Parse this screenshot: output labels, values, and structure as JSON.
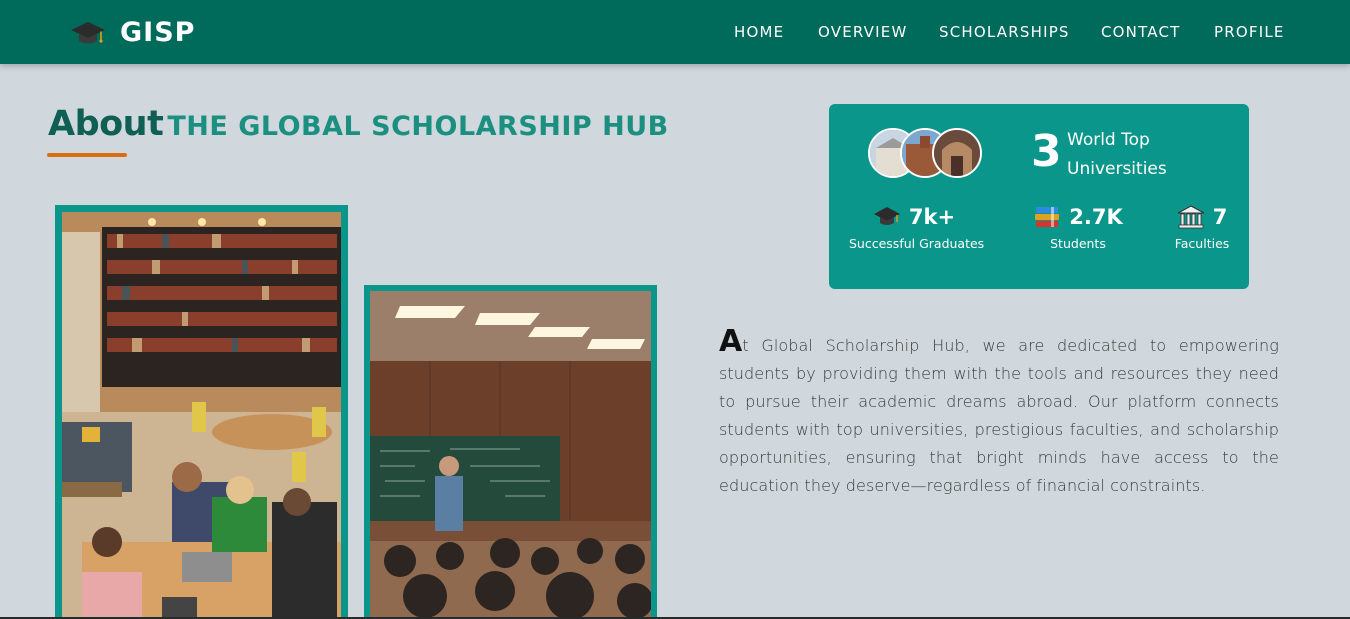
{
  "nav": {
    "brand": "GISP",
    "links": [
      "HOME",
      "OVERVIEW",
      "SCHOLARSHIPS",
      "CONTACT",
      "PROFILE"
    ]
  },
  "about": {
    "title": "About",
    "subtitle": "THE GLOBAL SCHOLARSHIP HUB"
  },
  "stats": {
    "universities_count": "3",
    "universities_label": "World Top Universities",
    "items": [
      {
        "value": "7k+",
        "label": "Successful Graduates",
        "icon": "graduation-cap-icon"
      },
      {
        "value": "2.7K",
        "label": "Students",
        "icon": "books-icon"
      },
      {
        "value": "7",
        "label": "Faculties",
        "icon": "institution-icon"
      }
    ]
  },
  "description": {
    "dropcap": "A",
    "text": "t Global Scholarship Hub, we are dedicated to empowering students by providing them with the tools and resources they need to pursue their academic dreams abroad. Our platform connects students with top universities, prestigious faculties, and scholarship opportunities, ensuring that bright minds have access to the education they deserve—regardless of financial constraints."
  },
  "colors": {
    "nav_bg": "#006a5b",
    "accent": "#0a968a",
    "underline": "#d86d12",
    "page_bg": "#d1d8dd"
  }
}
